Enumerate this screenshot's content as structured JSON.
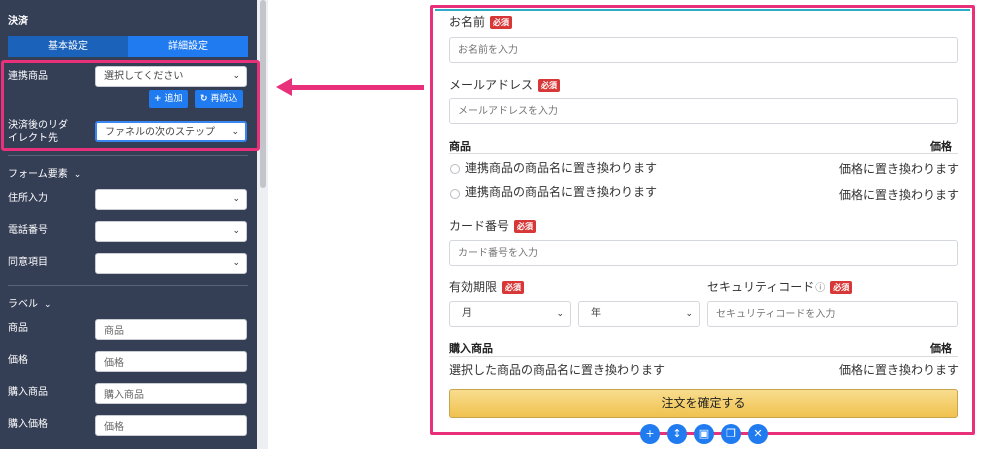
{
  "sidebar": {
    "title": "決済",
    "tabs": [
      "基本設定",
      "詳細設定"
    ],
    "linked_product": {
      "label": "連携商品",
      "value": "選択してください"
    },
    "add_button": "追加",
    "reload_button": "再読込",
    "redirect": {
      "label_line1": "決済後のリダ",
      "label_line2": "イレクト先",
      "value": "ファネルの次のステップ"
    },
    "form_elements_section": "フォーム要素",
    "form_elements": [
      {
        "label": "住所入力",
        "value": ""
      },
      {
        "label": "電話番号",
        "value": ""
      },
      {
        "label": "同意項目",
        "value": ""
      }
    ],
    "label_section": "ラベル",
    "labels": [
      {
        "label": "商品",
        "value": "商品"
      },
      {
        "label": "価格",
        "value": "価格"
      },
      {
        "label": "購入商品",
        "value": "購入商品"
      },
      {
        "label": "購入価格",
        "value": "価格"
      }
    ]
  },
  "form": {
    "name": {
      "label": "お名前",
      "required": "必須",
      "placeholder": "お名前を入力"
    },
    "email": {
      "label": "メールアドレス",
      "required": "必須",
      "placeholder": "メールアドレスを入力"
    },
    "products_header": "商品",
    "price_header": "価格",
    "product_rows": [
      {
        "name": "連携商品の商品名に置き換わります",
        "price": "価格に置き換わります"
      },
      {
        "name": "連携商品の商品名に置き換わります",
        "price": "価格に置き換わります"
      }
    ],
    "card": {
      "label": "カード番号",
      "required": "必須",
      "placeholder": "カード番号を入力"
    },
    "expiry": {
      "label": "有効期限",
      "required": "必須",
      "month": "月",
      "year": "年"
    },
    "security": {
      "label": "セキュリティコード",
      "help": "?",
      "required": "必須",
      "placeholder": "セキュリティコードを入力"
    },
    "purchased_header": "購入商品",
    "purchased_price_header": "価格",
    "purchased_row": {
      "name": "選択した商品の商品名に置き換わります",
      "price": "価格に置き換わります"
    },
    "submit": "注文を確定する"
  },
  "toolbar_icons": [
    "add-icon",
    "move-icon",
    "save-icon",
    "copy-icon",
    "delete-icon"
  ],
  "colors": {
    "sidebar_bg": "#343e55",
    "accent_blue": "#1f7bef",
    "highlight_pink": "#e8307b",
    "required_red": "#d73837",
    "button_gold": "#f0c24e"
  }
}
